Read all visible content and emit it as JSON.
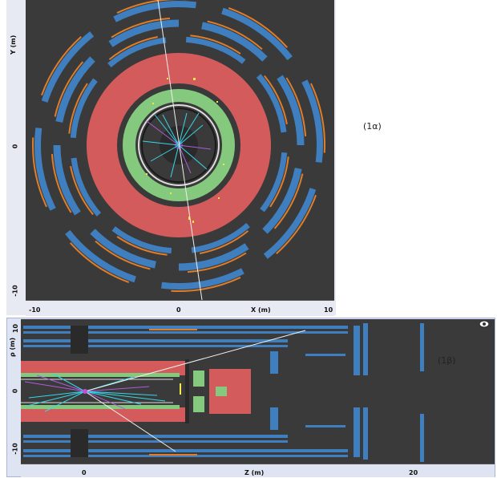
{
  "top_view": {
    "caption": "(1α)",
    "x_axis_label": "X (m)",
    "y_axis_label": "Y (m)",
    "x_ticks": [
      "-10",
      "0",
      "10"
    ],
    "y_ticks": [
      "0",
      "-10"
    ],
    "corner_mark": "- (",
    "colors": {
      "background": "#3a3a3a",
      "muon_chambers": "#3f7fbf",
      "muon_trigger": "#e07d28",
      "hadronic_calorimeter": "#d45b5b",
      "em_calorimeter": "#85c97e",
      "tracks": "#36d6e7"
    }
  },
  "side_view": {
    "caption": "(1β)",
    "x_axis_label": "Z (m)",
    "y_axis_label": "ρ (m)",
    "x_ticks": [
      "0",
      "20"
    ],
    "y_ticks": [
      "10",
      "0",
      "-10"
    ],
    "toolbar_icon": "eye-icon"
  }
}
